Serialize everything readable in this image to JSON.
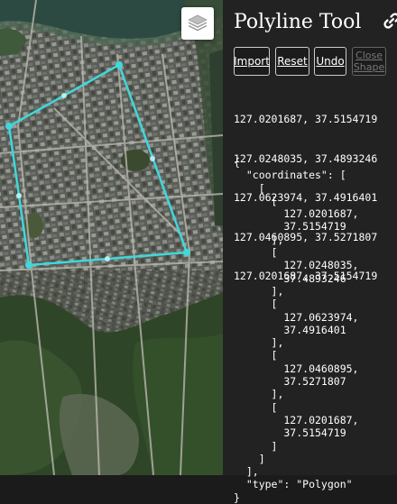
{
  "panel": {
    "title": "Polyline Tool",
    "buttons": {
      "import": "Import",
      "reset": "Reset",
      "undo": "Undo",
      "close_line1": "Close",
      "close_line2": "Shape"
    },
    "coordinate_lines": [
      "127.0201687, 37.5154719",
      "127.0248035, 37.4893246",
      "127.0623974, 37.4916401",
      "127.0460895, 37.5271807",
      "127.0201687, 37.5154719"
    ],
    "geojson_text": "{\n  \"coordinates\": [\n    [\n      [\n        127.0201687,\n        37.5154719\n      ],\n      [\n        127.0248035,\n        37.4893246\n      ],\n      [\n        127.0623974,\n        37.4916401\n      ],\n      [\n        127.0460895,\n        37.5271807\n      ],\n      [\n        127.0201687,\n        37.5154719\n      ]\n    ]\n  ],\n  \"type\": \"Polygon\"\n}"
  },
  "map": {
    "layers_icon": "layers-icon",
    "polygon_color": "#3fd8dc"
  },
  "icons": {
    "link": "link-icon"
  }
}
